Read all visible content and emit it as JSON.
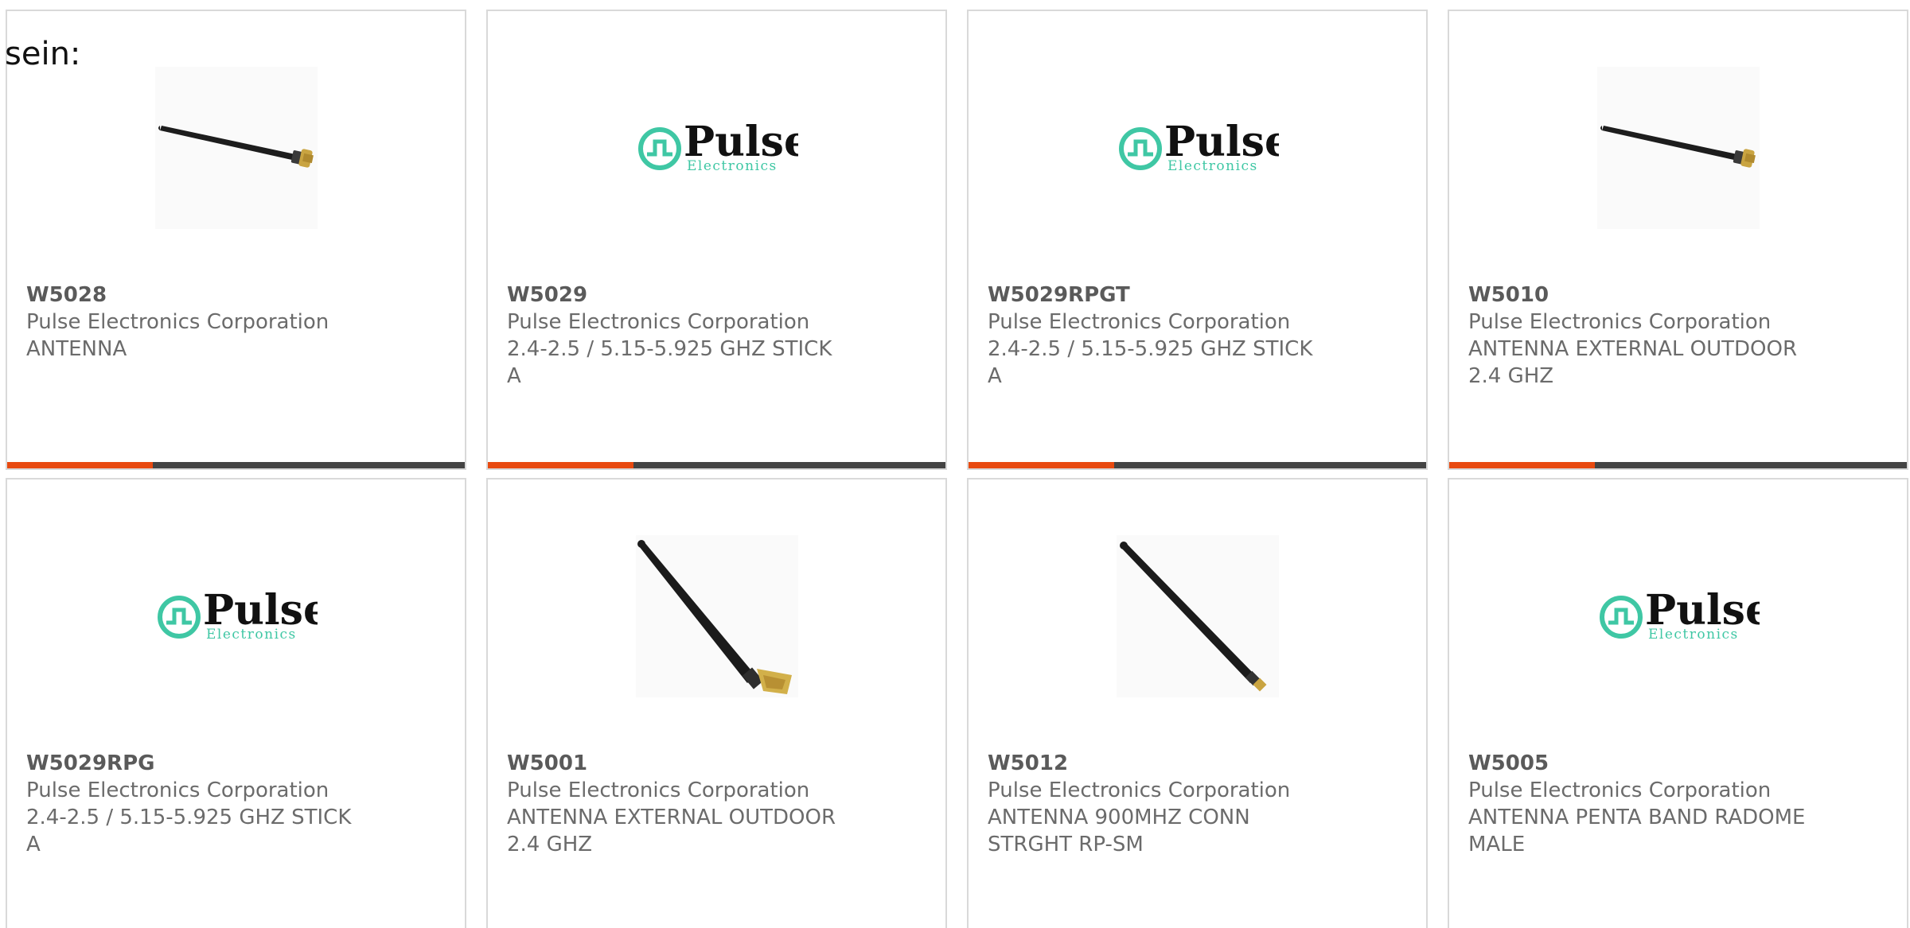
{
  "intro_text": "sein:",
  "colors": {
    "accent_bar": "#e84a10",
    "dark_bar": "#444444",
    "logo_teal": "#3fc7a4"
  },
  "products": [
    {
      "part_number": "W5028",
      "manufacturer": "Pulse Electronics Corporation",
      "description": "ANTENNA",
      "image": "antenna-short-photo"
    },
    {
      "part_number": "W5029",
      "manufacturer": "Pulse Electronics Corporation",
      "description": "2.4-2.5 / 5.15-5.925 GHZ STICK A",
      "image": "pulse-logo",
      "logo_word": "Pulse",
      "logo_sub": "Electronics"
    },
    {
      "part_number": "W5029RPGT",
      "manufacturer": "Pulse Electronics Corporation",
      "description": "2.4-2.5 / 5.15-5.925 GHZ STICK A",
      "image": "pulse-logo",
      "logo_word": "Pulse",
      "logo_sub": "Electronics"
    },
    {
      "part_number": "W5010",
      "manufacturer": "Pulse Electronics Corporation",
      "description": "ANTENNA EXTERNAL OUTDOOR 2.4 GHZ",
      "image": "antenna-short-photo"
    },
    {
      "part_number": "W5029RPG",
      "manufacturer": "Pulse Electronics Corporation",
      "description": "2.4-2.5 / 5.15-5.925 GHZ STICK A",
      "image": "pulse-logo",
      "logo_word": "Pulse",
      "logo_sub": "Electronics"
    },
    {
      "part_number": "W5001",
      "manufacturer": "Pulse Electronics Corporation",
      "description": "ANTENNA EXTERNAL OUTDOOR 2.4 GHZ",
      "image": "antenna-diagonal-photo"
    },
    {
      "part_number": "W5012",
      "manufacturer": "Pulse Electronics Corporation",
      "description": "ANTENNA 900MHZ CONN STRGHT RP-SM",
      "image": "antenna-long-photo"
    },
    {
      "part_number": "W5005",
      "manufacturer": "Pulse Electronics Corporation",
      "description": "ANTENNA PENTA BAND RADOME MALE",
      "image": "pulse-logo",
      "logo_word": "Pulse",
      "logo_sub": "Electronics"
    }
  ]
}
